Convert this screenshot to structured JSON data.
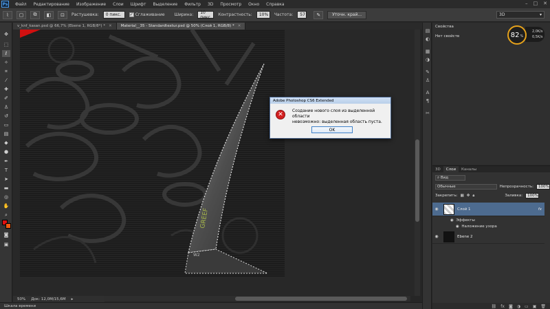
{
  "app": {
    "logo": "Ps",
    "menu": [
      "Файл",
      "Редактирование",
      "Изображение",
      "Слои",
      "Шрифт",
      "Выделение",
      "Фильтр",
      "3D",
      "Просмотр",
      "Окно",
      "Справка"
    ],
    "window_controls": [
      "–",
      "□",
      "✕"
    ]
  },
  "options_bar": {
    "feather_label": "Растушевка:",
    "feather_value": "0 пикс.",
    "antialias_label": "Сглаживание",
    "width_label": "Ширина:",
    "width_value": "10 пикс",
    "contrast_label": "Контрастность:",
    "contrast_value": "10%",
    "frequency_label": "Частота:",
    "frequency_value": "57",
    "refine_button": "Уточн. край...",
    "workspace": "3D"
  },
  "tabs": [
    {
      "label": "v_knf_kasan.psd @ 66,7% (Ebene 1, RGB/8*) *",
      "active": false
    },
    {
      "label": "Material__35 - Standardtextur.psd @ 50% (Слой 1, RGB/8) *",
      "active": true
    }
  ],
  "status": {
    "zoom": "50%",
    "doc_size": "Док: 12,0M/15,6M",
    "timeline": "Шкала времени"
  },
  "dialog": {
    "title": "Adobe Photoshop CS6 Extended",
    "message_line1": "Создание нового слоя из выделенной области",
    "message_line2": "невозможно: выделенная область пуста.",
    "ok_label": "OK",
    "error_icon": "✕"
  },
  "properties": {
    "tab_label": "Свойства",
    "no_properties": "Нет свойств",
    "gauge_value": "82",
    "gauge_unit": "%",
    "gauge_up": "2,0K/s",
    "gauge_down": "0,5K/s"
  },
  "layers_panel": {
    "tabs": [
      "3D",
      "Слои",
      "Каналы"
    ],
    "active_tab": "Слои",
    "filter_label": "Вид",
    "blend_mode": "Обычные",
    "opacity_label": "Непрозрачность:",
    "opacity_value": "100%",
    "lock_label": "Закрепить:",
    "fill_label": "Заливка:",
    "fill_value": "100%",
    "layers": [
      {
        "name": "Слой 1",
        "selected": true,
        "fx": "fx"
      },
      {
        "name": "Ebene 2",
        "selected": false
      }
    ],
    "effects_label": "Эффекты",
    "overlay_label": "Наложение узора"
  },
  "canvas": {
    "blade_text": "GREEF",
    "blade_small": "W2"
  }
}
